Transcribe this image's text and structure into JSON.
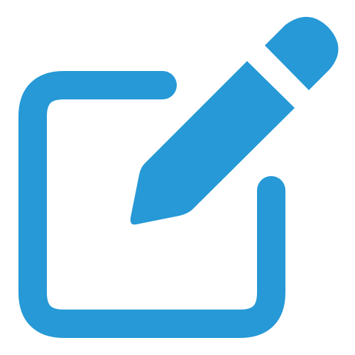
{
  "icon": {
    "name": "edit-icon",
    "parts": [
      "square-frame",
      "pencil"
    ],
    "color": "#2699D6",
    "background": "#FFFFFF"
  }
}
